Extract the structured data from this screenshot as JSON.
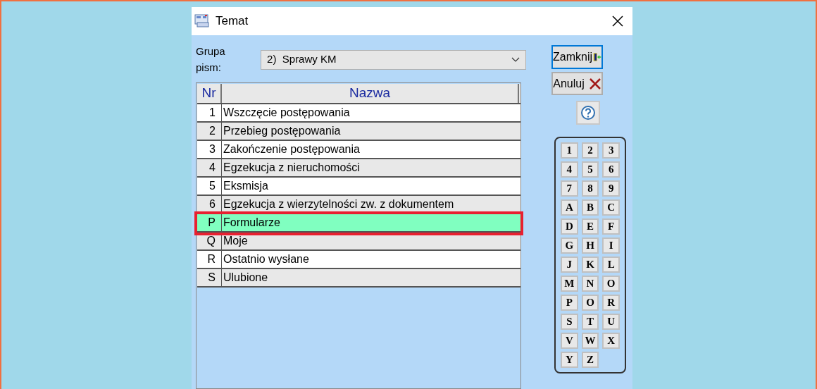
{
  "window": {
    "title": "Temat"
  },
  "group": {
    "label": "Grupa pism:",
    "value": "2)  Sprawy KM"
  },
  "table": {
    "columns": [
      "Nr",
      "Nazwa"
    ],
    "rows": [
      {
        "nr": "1",
        "name": "Wszczęcie postępowania",
        "selected": false
      },
      {
        "nr": "2",
        "name": "Przebieg postępowania",
        "selected": false
      },
      {
        "nr": "3",
        "name": "Zakończenie postępowania",
        "selected": false
      },
      {
        "nr": "4",
        "name": "Egzekucja z nieruchomości",
        "selected": false
      },
      {
        "nr": "5",
        "name": "Eksmisja",
        "selected": false
      },
      {
        "nr": "6",
        "name": "Egzekucja z wierzytelności zw. z dokumentem",
        "selected": false
      },
      {
        "nr": "P",
        "name": "Formularze",
        "selected": true
      },
      {
        "nr": "Q",
        "name": "Moje",
        "selected": false
      },
      {
        "nr": "R",
        "name": "Ostatnio wysłane",
        "selected": false
      },
      {
        "nr": "S",
        "name": "Ulubione",
        "selected": false
      }
    ]
  },
  "buttons": {
    "close": "Zamknij",
    "cancel": "Anuluj"
  },
  "keys": [
    "1",
    "2",
    "3",
    "4",
    "5",
    "6",
    "7",
    "8",
    "9",
    "A",
    "B",
    "C",
    "D",
    "E",
    "F",
    "G",
    "H",
    "I",
    "J",
    "K",
    "L",
    "M",
    "N",
    "O",
    "P",
    "O",
    "R",
    "S",
    "T",
    "U",
    "V",
    "W",
    "X",
    "Y",
    "Z"
  ]
}
